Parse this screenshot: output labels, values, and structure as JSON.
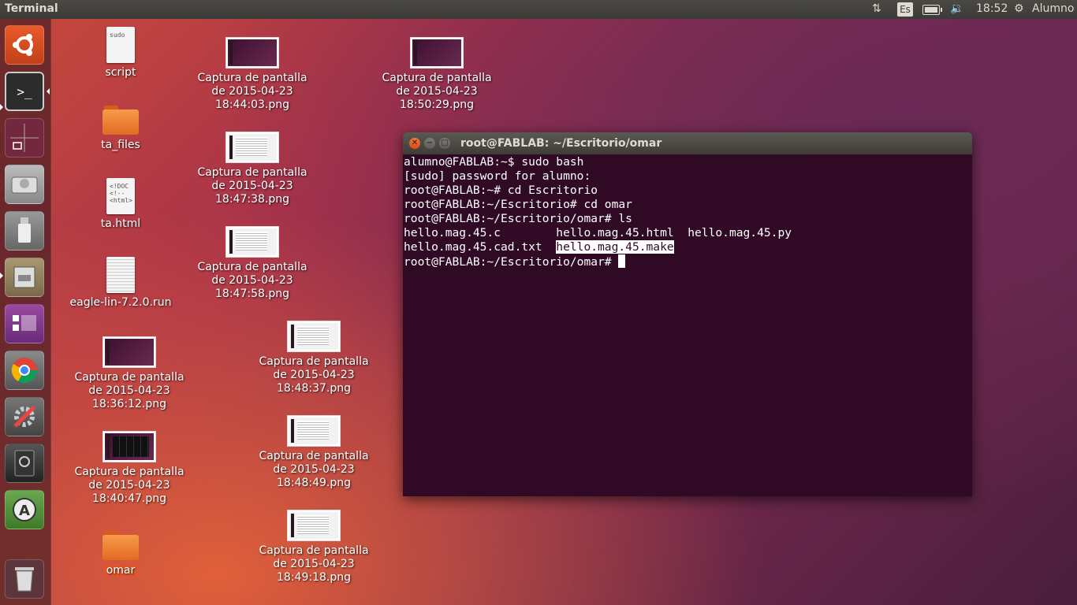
{
  "panel": {
    "title": "Terminal",
    "keyboard_layout": "Es",
    "time": "18:52",
    "user": "Alumno",
    "battery_level_percent": 80
  },
  "launcher": {
    "items": [
      {
        "name": "dash-home",
        "icon": "ubuntu-logo-icon"
      },
      {
        "name": "terminal",
        "icon": "terminal-icon"
      },
      {
        "name": "workspace-switcher",
        "icon": "workspace-switcher-icon"
      },
      {
        "name": "hard-disk",
        "icon": "hard-disk-icon"
      },
      {
        "name": "usb-drive",
        "icon": "usb-drive-icon"
      },
      {
        "name": "file-manager",
        "icon": "file-cabinet-icon"
      },
      {
        "name": "workspace",
        "icon": "workspace-icon"
      },
      {
        "name": "chrome",
        "icon": "chrome-icon"
      },
      {
        "name": "system-settings",
        "icon": "settings-icon"
      },
      {
        "name": "disk-utility",
        "icon": "disk-utility-icon"
      },
      {
        "name": "software-updater",
        "icon": "software-updater-icon"
      },
      {
        "name": "trash",
        "icon": "trash-icon"
      }
    ]
  },
  "desktop": {
    "script": {
      "label": "script",
      "preview": "sudo"
    },
    "ta_files": {
      "label": "ta_files"
    },
    "ta_html": {
      "label": "ta.html",
      "preview": "<!DOC\n<!--\n<html>"
    },
    "eagle": {
      "label": "eagle-lin-7.2.0.run"
    },
    "cap_183612": {
      "line1": "Captura de pantalla",
      "line2": "de 2015-04-23",
      "line3": "18:36:12.png"
    },
    "cap_184047": {
      "line1": "Captura de pantalla",
      "line2": "de 2015-04-23",
      "line3": "18:40:47.png"
    },
    "omar": {
      "label": "omar"
    },
    "cap_184403": {
      "line1": "Captura de pantalla",
      "line2": "de 2015-04-23",
      "line3": "18:44:03.png"
    },
    "cap_184738": {
      "line1": "Captura de pantalla",
      "line2": "de 2015-04-23",
      "line3": "18:47:38.png"
    },
    "cap_184758": {
      "line1": "Captura de pantalla",
      "line2": "de 2015-04-23",
      "line3": "18:47:58.png"
    },
    "cap_184837": {
      "line1": "Captura de pantalla",
      "line2": "de 2015-04-23",
      "line3": "18:48:37.png"
    },
    "cap_184849": {
      "line1": "Captura de pantalla",
      "line2": "de 2015-04-23",
      "line3": "18:48:49.png"
    },
    "cap_184918": {
      "line1": "Captura de pantalla",
      "line2": "de 2015-04-23",
      "line3": "18:49:18.png"
    },
    "cap_185029": {
      "line1": "Captura de pantalla",
      "line2": "de 2015-04-23",
      "line3": "18:50:29.png"
    }
  },
  "terminal": {
    "title": "root@FABLAB: ~/Escritorio/omar",
    "lines": [
      "alumno@FABLAB:~$ sudo bash",
      "[sudo] password for alumno:",
      "root@FABLAB:~# cd Escritorio",
      "root@FABLAB:~/Escritorio# cd omar",
      "root@FABLAB:~/Escritorio/omar# ls"
    ],
    "ls_row1": "hello.mag.45.c        hello.mag.45.html  hello.mag.45.py",
    "ls_row2_a": "hello.mag.45.cad.txt  ",
    "ls_row2_b": "hello.mag.45.make",
    "prompt": "root@FABLAB:~/Escritorio/omar# "
  }
}
